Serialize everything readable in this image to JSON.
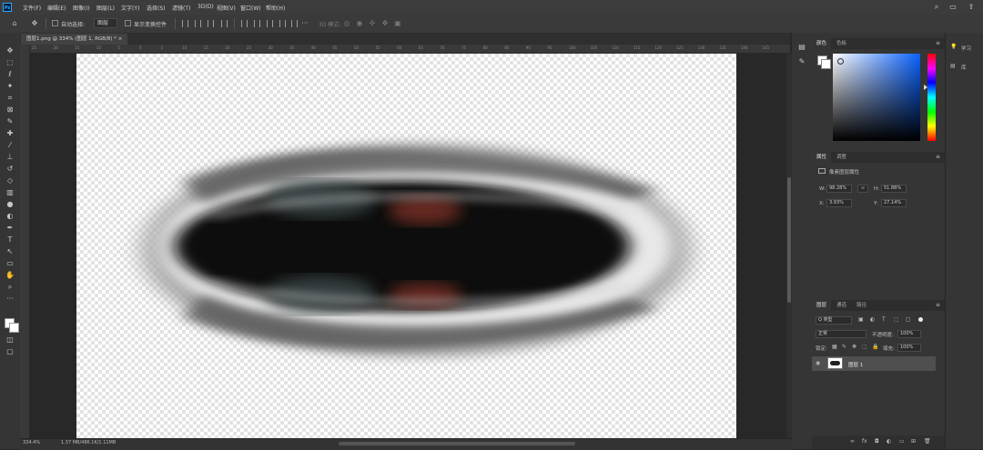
{
  "menu": [
    "文件(F)",
    "编辑(E)",
    "图像(I)",
    "图层(L)",
    "文字(Y)",
    "选择(S)",
    "滤镜(T)",
    "3D(D)",
    "视图(V)",
    "窗口(W)",
    "帮助(H)"
  ],
  "options": {
    "auto_select_label": "自动选择:",
    "auto_select_value": "图层",
    "show_transform_label": "显示变换控件",
    "mode_3d_label": "3D 模式:"
  },
  "document": {
    "tab_label": "图层1.png @ 334% (图层 1, RGB/8) *",
    "zoom": "334.4%",
    "doc_size": "1.37 MB/486.1K/1.11MB"
  },
  "ruler_ticks": [
    "25",
    "20",
    "15",
    "10",
    "5",
    "0",
    "5",
    "10",
    "15",
    "20",
    "25",
    "30",
    "35",
    "40",
    "45",
    "50",
    "55",
    "60",
    "65",
    "70",
    "75",
    "80",
    "85",
    "90",
    "95",
    "100",
    "105",
    "110",
    "115",
    "120",
    "125",
    "130",
    "135",
    "140",
    "145"
  ],
  "color_panel": {
    "tabs": [
      "颜色",
      "色板"
    ],
    "hue_color": "#0a62ff"
  },
  "properties_panel": {
    "tabs": [
      "属性",
      "调整"
    ],
    "title": "像素图层属性",
    "w_label": "W:",
    "w_value": "98.28%",
    "h_label": "H:",
    "h_value": "51.88%",
    "x_label": "X:",
    "x_value": "3.93%",
    "y_label": "Y:",
    "y_value": "27.14%",
    "link_icon": "∞"
  },
  "layers_panel": {
    "tabs": [
      "图层",
      "通道",
      "路径"
    ],
    "filter_kind": "Q 类型",
    "blend_mode": "正常",
    "opacity_label": "不透明度:",
    "opacity_value": "100%",
    "lock_label": "锁定:",
    "fill_label": "填充:",
    "fill_value": "100%",
    "layer_name": "图层 1"
  },
  "learn": {
    "learn_label": "学习",
    "library_label": "库"
  }
}
